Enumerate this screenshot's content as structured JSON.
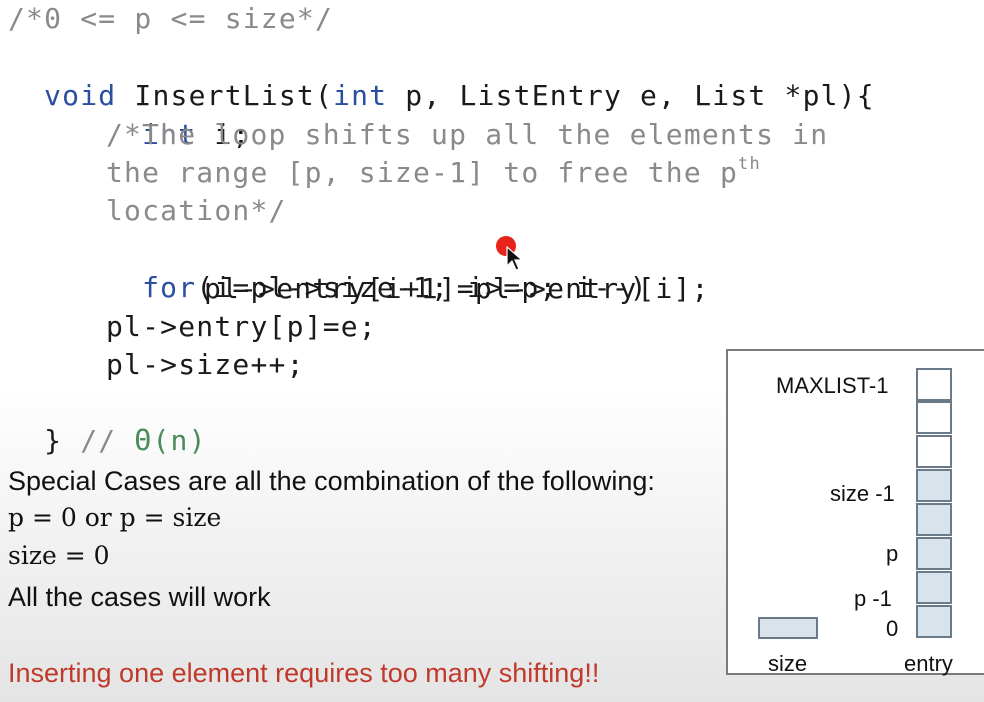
{
  "code": {
    "line1": "/*0 <= p <= size*/",
    "line2_kw": "void",
    "line2_rest": " InsertList(",
    "line2_int": "int",
    "line2_tail": " p, ListEntry e, List *pl){",
    "line3_kw": "int",
    "line3_rest": " i;",
    "line4": "/*The loop shifts up all the elements in",
    "line5": "the range [p, size-1] to free the p",
    "line5_sup": "th",
    "line6": "location*/",
    "line7_kw": "for",
    "line7_rest": "(i=pl->size-1; i>=p; i--)",
    "line8": "pl->entry[i+1]=pl->entry[i];",
    "line9": "pl->entry[p]=e;",
    "line10": "pl->size++;",
    "line11_brace": "}",
    "line11_cmt": " // ",
    "line11_theta": "Θ(n)"
  },
  "notes": {
    "special_cases": "Special Cases are all the combination of the following:",
    "case1": "p = 0 or p = size",
    "case2": "size = 0",
    "all_work": "All the cases will work",
    "warning": "Inserting one element requires too many shifting!!"
  },
  "diagram": {
    "label_maxlist": "MAXLIST-1",
    "label_size_minus_1": "size -1",
    "label_p": "p",
    "label_p_minus_1": "p -1",
    "label_zero": "0",
    "label_size": "size",
    "label_entry": "entry"
  },
  "colors": {
    "comment": "#8a8a8a",
    "keyword": "#2b4fa0",
    "warning": "#c0392b",
    "cell_fill": "#d8e3ec",
    "cursor_dot": "#e8231c"
  },
  "icons": {
    "cursor": "mouse-pointer-icon",
    "laser": "laser-pointer-icon"
  }
}
